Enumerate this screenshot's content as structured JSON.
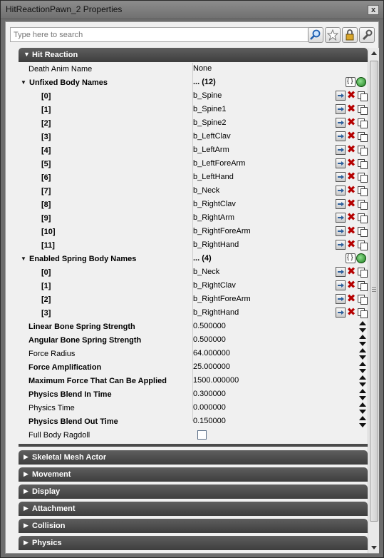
{
  "window": {
    "title": "HitReactionPawn_2 Properties",
    "close_label": "x"
  },
  "search": {
    "placeholder": "Type here to search"
  },
  "toolbar": [
    "search-icon",
    "star-icon",
    "lock-icon",
    "wrench-icon"
  ],
  "sections": {
    "hit_reaction": {
      "label": "Hit Reaction",
      "expanded": true
    },
    "collapsed": [
      {
        "label": "Skeletal Mesh Actor"
      },
      {
        "label": "Movement"
      },
      {
        "label": "Display"
      },
      {
        "label": "Attachment"
      },
      {
        "label": "Collision"
      },
      {
        "label": "Physics"
      }
    ]
  },
  "properties": {
    "death_anim_name": {
      "label": "Death Anim Name",
      "value": "None"
    },
    "unfixed_body_names": {
      "label": "Unfixed Body Names",
      "value": "... (12)",
      "items": [
        {
          "index": "[0]",
          "value": "b_Spine"
        },
        {
          "index": "[1]",
          "value": "b_Spine1"
        },
        {
          "index": "[2]",
          "value": "b_Spine2"
        },
        {
          "index": "[3]",
          "value": "b_LeftClav"
        },
        {
          "index": "[4]",
          "value": "b_LeftArm"
        },
        {
          "index": "[5]",
          "value": "b_LeftForeArm"
        },
        {
          "index": "[6]",
          "value": "b_LeftHand"
        },
        {
          "index": "[7]",
          "value": "b_Neck"
        },
        {
          "index": "[8]",
          "value": "b_RightClav"
        },
        {
          "index": "[9]",
          "value": "b_RightArm"
        },
        {
          "index": "[10]",
          "value": "b_RightForeArm"
        },
        {
          "index": "[11]",
          "value": "b_RightHand"
        }
      ]
    },
    "enabled_spring_body_names": {
      "label": "Enabled Spring Body Names",
      "value": "... (4)",
      "items": [
        {
          "index": "[0]",
          "value": "b_Neck"
        },
        {
          "index": "[1]",
          "value": "b_RightClav"
        },
        {
          "index": "[2]",
          "value": "b_RightForeArm"
        },
        {
          "index": "[3]",
          "value": "b_RightHand"
        }
      ]
    },
    "linear_bone_spring_strength": {
      "label": "Linear Bone Spring Strength",
      "value": "0.500000"
    },
    "angular_bone_spring_strength": {
      "label": "Angular Bone Spring Strength",
      "value": "0.500000"
    },
    "force_radius": {
      "label": "Force Radius",
      "value": "64.000000"
    },
    "force_amplification": {
      "label": "Force Amplification",
      "value": "25.000000"
    },
    "maximum_force": {
      "label": "Maximum Force That Can Be Applied",
      "value": "1500.000000"
    },
    "physics_blend_in_time": {
      "label": "Physics Blend In Time",
      "value": "0.300000"
    },
    "physics_time": {
      "label": "Physics Time",
      "value": "0.000000"
    },
    "physics_blend_out_time": {
      "label": "Physics Blend Out Time",
      "value": "0.150000"
    },
    "full_body_ragdoll": {
      "label": "Full Body Ragdoll",
      "checked": false
    }
  },
  "colors": {
    "section_header": "#4a4a4a",
    "delete_icon": "#b50000",
    "background": "#f0f0f0"
  }
}
